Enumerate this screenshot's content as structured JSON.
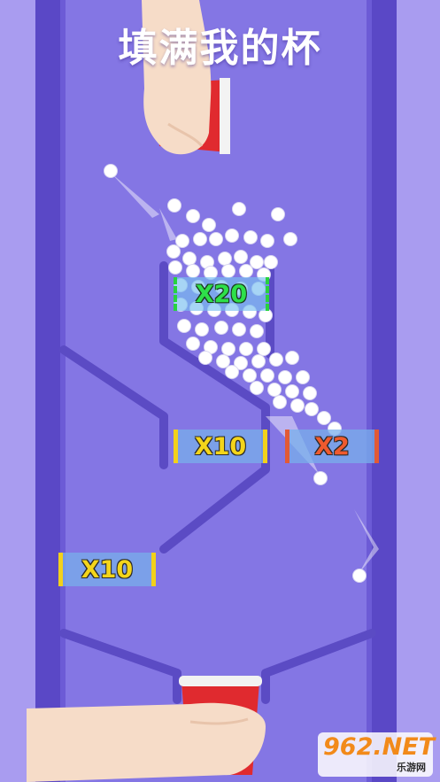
{
  "title": "填满我的杯",
  "colors": {
    "background": "#a99cf0",
    "track": "#7d6fde",
    "wall": "#5b4bc4",
    "cup": "#e02a2f",
    "ball": "#ffffff"
  },
  "gates": {
    "x20": "X20",
    "x10_upper": "X10",
    "x2": "X2",
    "x10_lower": "X10"
  },
  "watermark": {
    "brand": "962.NET",
    "site": "乐游网"
  }
}
